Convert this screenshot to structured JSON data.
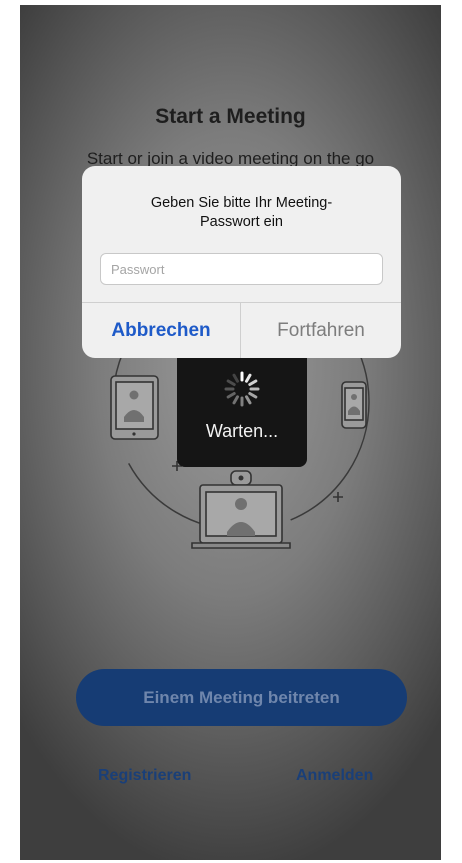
{
  "header": {
    "title": "Start a Meeting",
    "subtitle": "Start or join a video meeting on the go"
  },
  "dialog": {
    "message": "Geben Sie bitte Ihr Meeting-\nPasswort ein",
    "password_placeholder": "Passwort",
    "password_value": "",
    "cancel_label": "Abbrechen",
    "continue_label": "Fortfahren"
  },
  "loading": {
    "label": "Warten..."
  },
  "actions": {
    "join_label": "Einem Meeting beitreten",
    "register_label": "Registrieren",
    "login_label": "Anmelden"
  },
  "colors": {
    "accent_blue": "#1e5ac8",
    "join_button": "#163c74",
    "link_blue": "#1a3f78"
  }
}
